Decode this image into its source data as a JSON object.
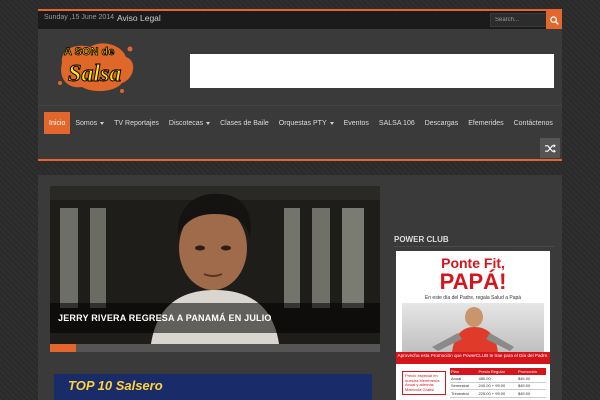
{
  "topbar": {
    "date": "Sunday ,15 June 2014",
    "link": "Aviso Legal",
    "search_placeholder": "Search..."
  },
  "logo": {
    "text_top": "A SON de",
    "text_main": "Salsa"
  },
  "nav": {
    "items": [
      {
        "label": "Inicio",
        "active": true,
        "dropdown": false
      },
      {
        "label": "Somos",
        "active": false,
        "dropdown": true
      },
      {
        "label": "TV Reportajes",
        "active": false,
        "dropdown": false
      },
      {
        "label": "Discotecas",
        "active": false,
        "dropdown": true
      },
      {
        "label": "Clases de Baile",
        "active": false,
        "dropdown": false
      },
      {
        "label": "Orquestas PTY",
        "active": false,
        "dropdown": true
      },
      {
        "label": "Eventos",
        "active": false,
        "dropdown": false
      },
      {
        "label": "SALSA 106",
        "active": false,
        "dropdown": false
      },
      {
        "label": "Descargas",
        "active": false,
        "dropdown": false
      },
      {
        "label": "Efemerides",
        "active": false,
        "dropdown": false
      },
      {
        "label": "Contáctenos",
        "active": false,
        "dropdown": false
      }
    ]
  },
  "slider": {
    "caption": "Jerry Rivera regresa a Panamá en julio",
    "progress": 0.08
  },
  "banner2": {
    "text": "TOP 10 Salsero"
  },
  "sidebar": {
    "title": "Power Club",
    "promo": {
      "line1": "Ponte Fit,",
      "line2": "PAPÁ!",
      "line3": "En este día del Padre, regala Salud a Papá",
      "bar": "Aprovecha esta Promoción que PowerCLUB te trae para el Día del Padre.",
      "box": "Precio especial en nuestra Membresía Anual y además Matrícula Gratis!",
      "table_headers": [
        "Plan",
        "Precio Regular",
        "Promoción"
      ],
      "table_rows": [
        [
          "Anual",
          "480.00",
          "$45.00"
        ],
        [
          "Semestral",
          "240.00 + 99.00",
          "$45.00"
        ],
        [
          "Trimestral",
          "225.00 + 99.00",
          "$45.00"
        ]
      ]
    }
  },
  "colors": {
    "accent": "#e3672c",
    "background": "#2a2a2a",
    "panel": "#3a3a3a"
  }
}
